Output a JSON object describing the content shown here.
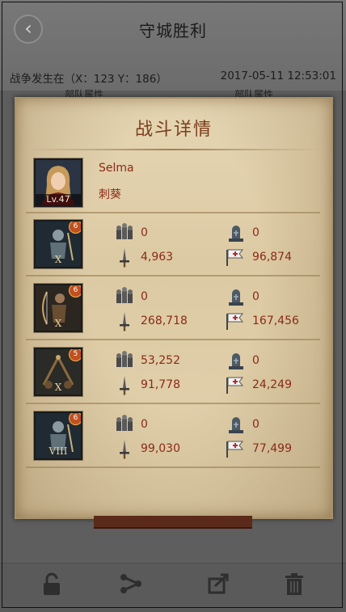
{
  "header": {
    "title": "守城胜利",
    "back_icon": "chevron-left-icon"
  },
  "battle": {
    "location": "战争发生在（X：123 Y：186）",
    "time": "2017-05-11 12:53:01",
    "attr_left": "部队属性",
    "attr_right": "部队属性"
  },
  "panel": {
    "title": "战斗详情",
    "hero": {
      "name": "Selma",
      "role": "刺葵",
      "level": "Lv.47"
    },
    "troops": [
      {
        "badge": "6",
        "tier": "X",
        "kind": "infantry",
        "stats": {
          "a": "0",
          "b": "0",
          "c": "4,963",
          "d": "96,874"
        }
      },
      {
        "badge": "6",
        "tier": "X",
        "kind": "archer",
        "stats": {
          "a": "0",
          "b": "0",
          "c": "268,718",
          "d": "167,456"
        }
      },
      {
        "badge": "5",
        "tier": "X",
        "kind": "siege",
        "stats": {
          "a": "53,252",
          "b": "0",
          "c": "91,778",
          "d": "24,249"
        }
      },
      {
        "badge": "6",
        "tier": "VIII",
        "kind": "infantry",
        "stats": {
          "a": "0",
          "b": "0",
          "c": "99,030",
          "d": "77,499"
        }
      }
    ]
  },
  "bottom_bar": [
    "lock-icon",
    "share-icon",
    "export-icon",
    "trash-icon"
  ]
}
